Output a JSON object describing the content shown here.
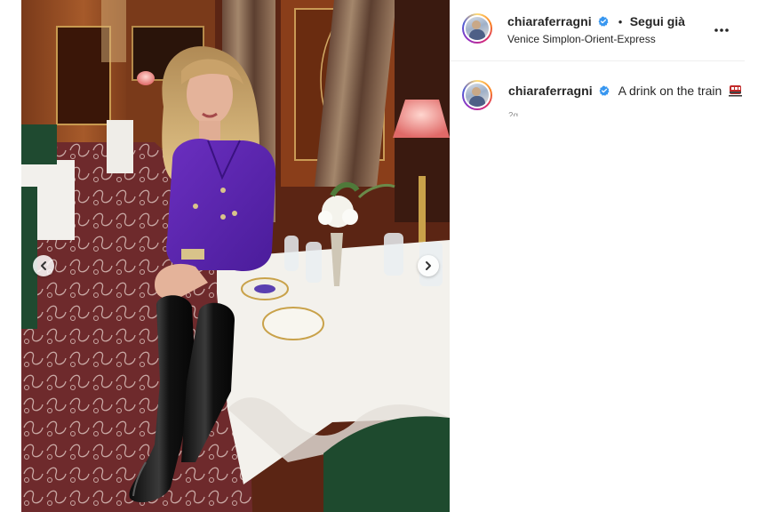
{
  "post": {
    "username": "chiaraferragni",
    "follow_status": "Segui già",
    "separator": "•",
    "location": "Venice Simplon-Orient-Express",
    "more_icon": "more-horizontal-icon",
    "verified_icon": "verified-badge-icon",
    "verified_color": "#3897f0"
  },
  "caption": {
    "username": "chiaraferragni",
    "text": "A drink on the train",
    "emoji": "train-icon",
    "timestamp": "2g"
  },
  "carousel": {
    "prev_icon": "chevron-left-icon",
    "next_icon": "chevron-right-icon"
  }
}
